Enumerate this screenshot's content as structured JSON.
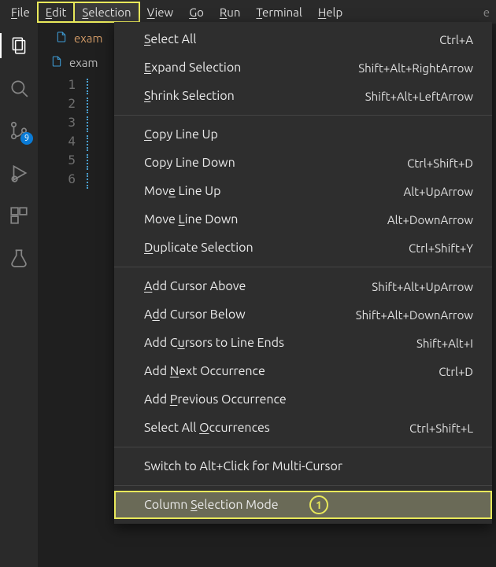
{
  "menubar": {
    "items": [
      "File",
      "Edit",
      "Selection",
      "View",
      "Go",
      "Run",
      "Terminal",
      "Help"
    ],
    "mnems": [
      0,
      0,
      0,
      0,
      0,
      0,
      0,
      0
    ],
    "open_index": 2,
    "outlined_index": 1,
    "overflow": "e"
  },
  "activity": {
    "badge": "9"
  },
  "tab": {
    "label": "exam",
    "breadcrumb": "exam"
  },
  "line_numbers": [
    1,
    2,
    3,
    4,
    5,
    6
  ],
  "dropdown": {
    "groups": [
      [
        {
          "label": "Select All",
          "mnem": 0,
          "accel": "Ctrl+A"
        },
        {
          "label": "Expand Selection",
          "mnem": 0,
          "accel": "Shift+Alt+RightArrow"
        },
        {
          "label": "Shrink Selection",
          "mnem": 0,
          "accel": "Shift+Alt+LeftArrow"
        }
      ],
      [
        {
          "label": "Copy Line Up",
          "mnem": 0,
          "accel": ""
        },
        {
          "label": "Copy Line Down",
          "mnem": null,
          "accel": "Ctrl+Shift+D"
        },
        {
          "label": "Move Line Up",
          "mnem": 3,
          "accel": "Alt+UpArrow"
        },
        {
          "label": "Move Line Down",
          "mnem": 5,
          "accel": "Alt+DownArrow"
        },
        {
          "label": "Duplicate Selection",
          "mnem": 0,
          "accel": "Ctrl+Shift+Y"
        }
      ],
      [
        {
          "label": "Add Cursor Above",
          "mnem": 0,
          "accel": "Shift+Alt+UpArrow"
        },
        {
          "label": "Add Cursor Below",
          "mnem": 1,
          "accel": "Shift+Alt+DownArrow"
        },
        {
          "label": "Add Cursors to Line Ends",
          "mnem": 5,
          "accel": "Shift+Alt+I"
        },
        {
          "label": "Add Next Occurrence",
          "mnem": 4,
          "accel": "Ctrl+D"
        },
        {
          "label": "Add Previous Occurrence",
          "mnem": 4,
          "accel": ""
        },
        {
          "label": "Select All Occurrences",
          "mnem": 11,
          "accel": "Ctrl+Shift+L"
        }
      ],
      [
        {
          "label": "Switch to Alt+Click for Multi-Cursor",
          "mnem": null,
          "accel": ""
        }
      ],
      [
        {
          "label": "Column Selection Mode",
          "mnem": 7,
          "accel": "",
          "highlight": true,
          "badge": "1"
        }
      ]
    ]
  }
}
